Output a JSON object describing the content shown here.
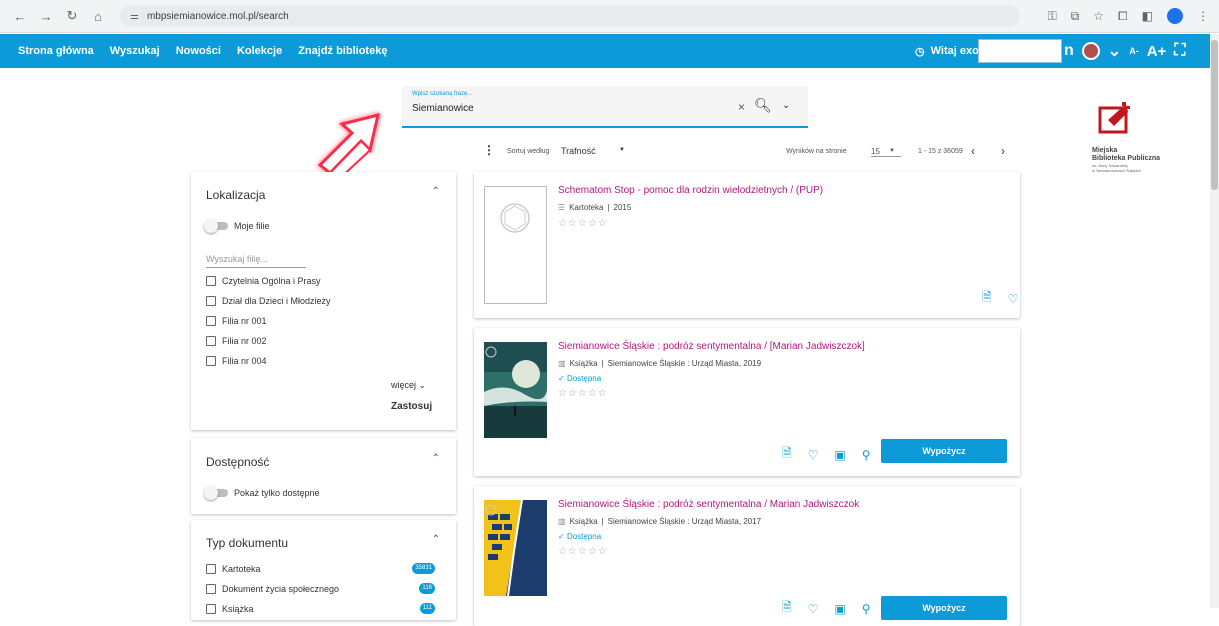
{
  "browser": {
    "url": "mbpsiemianowice.mol.pl/search"
  },
  "topbar": {
    "menu": [
      "Strona główna",
      "Wyszukaj",
      "Nowości",
      "Kolekcje",
      "Znajdź bibliotekę"
    ],
    "user_greeting": "Witaj exo",
    "user_tail": "n",
    "small_a": "A-",
    "big_a": "A+",
    "accent": "#0d9ad8"
  },
  "search": {
    "label": "Wpisz szukaną frazę...",
    "value": "Siemianowice"
  },
  "logo": {
    "line1": "Miejska",
    "line2": "Biblioteka Publiczna",
    "line3": "im. Anny Szwarckiej",
    "line4": "w Siemianowicach Śląskich"
  },
  "sort": {
    "label": "Sortuj według",
    "value": "Trafność",
    "per_page_label": "Wyników na stronie",
    "per_page": "15",
    "range": "1 - 15 z 36059"
  },
  "filters": {
    "location": {
      "title": "Lokalizacja",
      "toggle": "Moje filie",
      "input_placeholder": "Wyszukaj filię...",
      "options": [
        "Czytelnia Ogólna i Prasy",
        "Dział dla Dzieci i Młodzieży",
        "Filia nr 001",
        "Filia nr 002",
        "Filia nr 004"
      ],
      "more": "więcej",
      "apply": "Zastosuj"
    },
    "availability": {
      "title": "Dostępność",
      "toggle": "Pokaż tylko dostępne"
    },
    "doctype": {
      "title": "Typ dokumentu",
      "options": [
        {
          "label": "Kartoteka",
          "count": "35831"
        },
        {
          "label": "Dokument życia społecznego",
          "count": "116"
        },
        {
          "label": "Książka",
          "count": "111"
        }
      ]
    }
  },
  "results": [
    {
      "title": "Schematom Stop - pomoc dla rodzin wielodzietnych / (PUP)",
      "type": "Kartoteka",
      "meta": "2015",
      "availability": "",
      "stars": "☆☆☆☆☆"
    },
    {
      "title": "Siemianowice Śląskie : podróż sentymentalna / [Marian Jadwiszczok]",
      "type": "Książka",
      "meta": "Siemianowice Śląskie : Urząd Miasta, 2019",
      "availability": "Dostępna",
      "stars": "☆☆☆☆☆",
      "borrow": "Wypożycz"
    },
    {
      "title": "Siemianowice Śląskie : podróż sentymentalna / Marian Jadwiszczok",
      "type": "Książka",
      "meta": "Siemianowice Śląskie : Urząd Miasta, 2017",
      "availability": "Dostępna",
      "stars": "☆☆☆☆☆",
      "borrow": "Wypożycz"
    }
  ]
}
